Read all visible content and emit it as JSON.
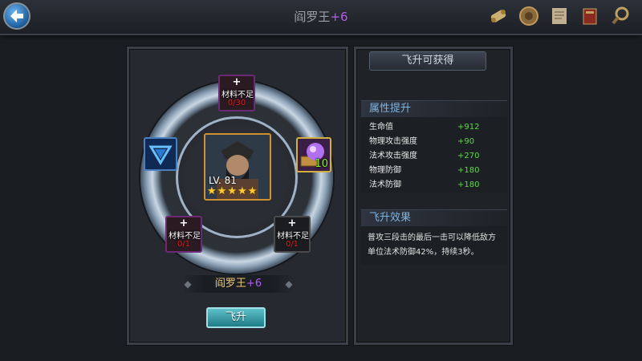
{
  "header": {
    "title_name": "阎罗王",
    "title_plus": "+6"
  },
  "top_icons": [
    "scroll-icon",
    "coin-icon",
    "map-icon",
    "book-icon",
    "magnifier-icon"
  ],
  "ascension": {
    "hero_level": "LV. 81",
    "hero_stars": 5,
    "slots": {
      "top": {
        "plus": "+",
        "label": "材料不足",
        "count": "0/30"
      },
      "bottom_left": {
        "plus": "+",
        "label": "材料不足",
        "count": "0/1"
      },
      "bottom_right": {
        "plus": "+",
        "label": "材料不足",
        "count": "0/1"
      },
      "right_qty": "10"
    },
    "name": "阎罗王",
    "name_plus": "+6",
    "button": "飞升"
  },
  "rewards": {
    "header": "飞升可获得",
    "attr_title": "属性提升",
    "attributes": [
      {
        "name": "生命值",
        "value": "+912"
      },
      {
        "name": "物理攻击强度",
        "value": "+90"
      },
      {
        "name": "法术攻击强度",
        "value": "+270"
      },
      {
        "name": "物理防御",
        "value": "+180"
      },
      {
        "name": "法术防御",
        "value": "+180"
      }
    ],
    "effect_title": "飞升效果",
    "effect_text": "普攻三段击的最后一击可以降低敌方单位法术防御42%，持续3秒。"
  },
  "colors": {
    "accent_purple": "#b45cf0",
    "positive_green": "#5fd848",
    "warning_red": "#e02020",
    "button_teal": "#1f7c86"
  }
}
